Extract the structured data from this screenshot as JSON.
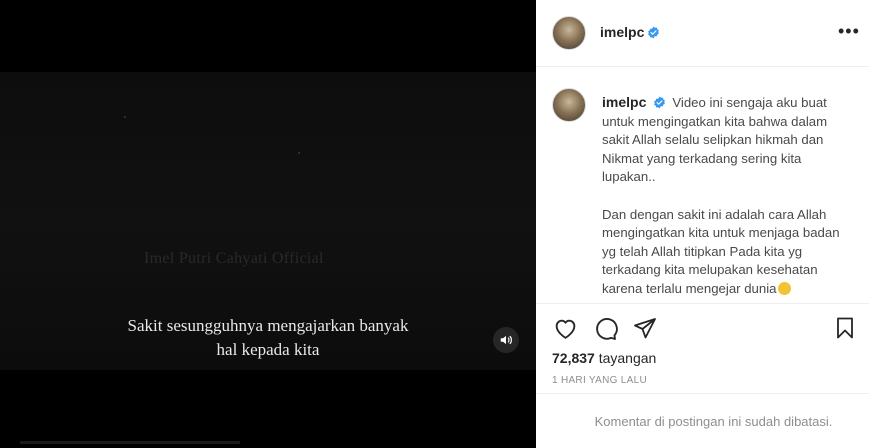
{
  "video": {
    "watermark": "Imel Putri Cahyati Official",
    "caption_line1": "Sakit sesungguhnya mengajarkan banyak",
    "caption_line2": "hal kepada kita",
    "sound_icon": "speaker-icon"
  },
  "post": {
    "username": "imelpc",
    "verified": true,
    "caption_p1": "Video ini sengaja aku buat untuk mengingatkan kita bahwa dalam sakit Allah selalu selipkan hikmah dan Nikmat yang terkadang sering kita lupakan..",
    "caption_p2": "Dan dengan sakit ini adalah cara Allah mengingatkan kita untuk menjaga badan yg telah Allah titipkan Pada kita yg terkadang kita melupakan kesehatan karena terlalu mengejar dunia",
    "views_number": "72,837",
    "views_label": "tayangan",
    "time": "1 HARI YANG LALU",
    "comments_disabled": "Komentar di postingan ini sudah dibatasi."
  },
  "colors": {
    "verified_blue": "#3897f0",
    "text": "#262626",
    "muted": "#8e8e8e"
  }
}
